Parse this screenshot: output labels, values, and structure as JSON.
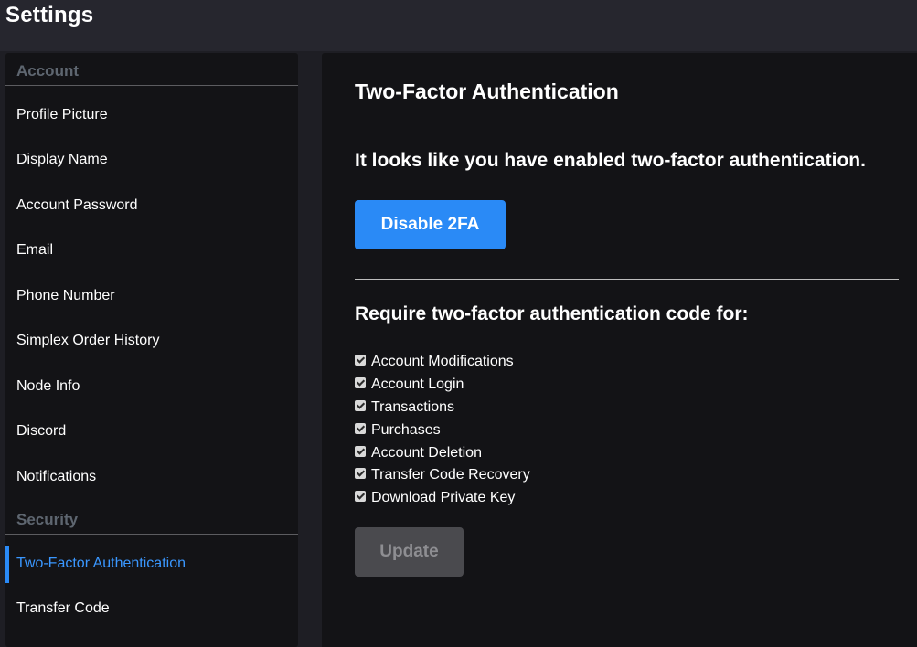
{
  "header": {
    "title": "Settings"
  },
  "sidebar": {
    "sections": [
      {
        "title": "Account",
        "items": [
          {
            "label": "Profile Picture"
          },
          {
            "label": "Display Name"
          },
          {
            "label": "Account Password"
          },
          {
            "label": "Email"
          },
          {
            "label": "Phone Number"
          },
          {
            "label": "Simplex Order History"
          },
          {
            "label": "Node Info"
          },
          {
            "label": "Discord"
          },
          {
            "label": "Notifications"
          }
        ]
      },
      {
        "title": "Security",
        "items": [
          {
            "label": "Two-Factor Authentication",
            "active": true
          },
          {
            "label": "Transfer Code"
          }
        ]
      }
    ]
  },
  "main": {
    "title": "Two-Factor Authentication",
    "status_text": "It looks like you have enabled two-factor authentication.",
    "disable_button_label": "Disable 2FA",
    "require_heading": "Require two-factor authentication code for:",
    "options": [
      {
        "label": "Account Modifications",
        "checked": true
      },
      {
        "label": "Account Login",
        "checked": true
      },
      {
        "label": "Transactions",
        "checked": true
      },
      {
        "label": "Purchases",
        "checked": true
      },
      {
        "label": "Account Deletion",
        "checked": true
      },
      {
        "label": "Transfer Code Recovery",
        "checked": true
      },
      {
        "label": "Download Private Key",
        "checked": true
      }
    ],
    "update_button_label": "Update",
    "update_button_disabled": true
  },
  "colors": {
    "accent": "#2a8af6",
    "active_nav_text": "#3a97ff",
    "section_header_text": "#5e6670",
    "panel_background": "#131316",
    "page_background": "#1e1e24"
  }
}
